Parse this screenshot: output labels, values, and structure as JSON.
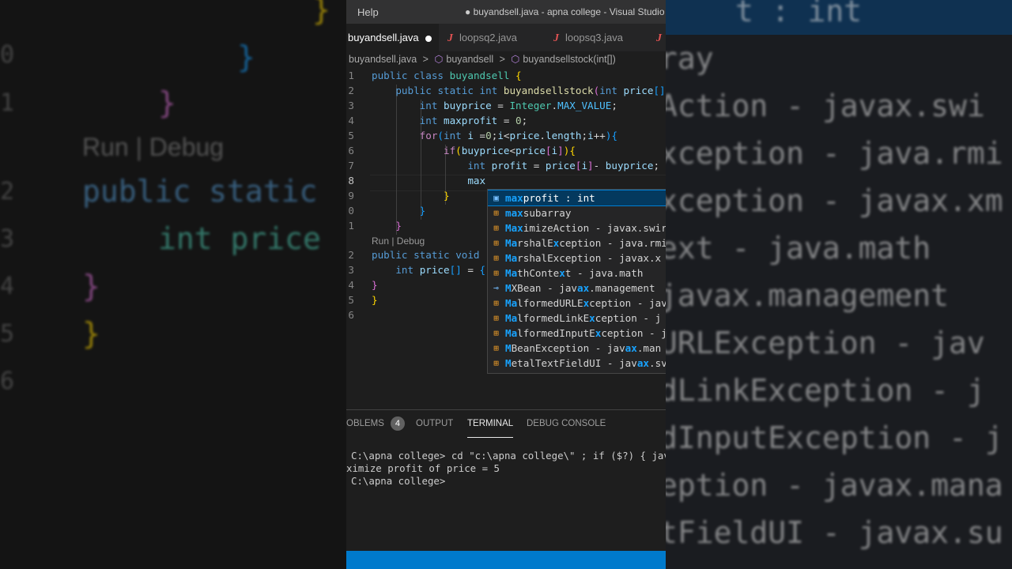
{
  "titlebar": {
    "menu_help": "Help",
    "window_title": "● buyandsell.java - apna college - Visual Studio C"
  },
  "tabs": [
    {
      "label": "buyandsell.java",
      "active": true,
      "modified": true
    },
    {
      "label": "loopsq2.java",
      "active": false
    },
    {
      "label": "loopsq3.java",
      "active": false
    },
    {
      "label": "J",
      "active": false
    }
  ],
  "breadcrumb": [
    "buyandsell.java",
    ">",
    "buyandsell",
    ">",
    "buyandsellstock(int[])"
  ],
  "editor": {
    "line_numbers": [
      "1",
      "2",
      "3",
      "4",
      "5",
      "6",
      "7",
      "8",
      "9",
      "0",
      "1",
      "2",
      "3",
      "4",
      "5",
      "6"
    ],
    "codelens": "Run | Debug",
    "typed": "max"
  },
  "suggestions": [
    {
      "match": "max",
      "rest": "profit : int",
      "kind": "field-icon",
      "selected": true
    },
    {
      "match": "max",
      "rest": "subarray",
      "kind": "class-icon"
    },
    {
      "match": "Max",
      "rest": "imizeAction - javax.swir",
      "kind": "class-icon"
    },
    {
      "match": "Ma",
      "rest": "rshalE",
      "x": "x",
      "rest2": "ception - java.rmi",
      "kind": "class-icon"
    },
    {
      "match": "Ma",
      "rest": "rshalException - javax.x",
      "kind": "class-icon"
    },
    {
      "match": "Ma",
      "rest": "thConte",
      "x": "x",
      "rest2": "t - java.math",
      "kind": "class-icon"
    },
    {
      "match": "M",
      "rest": "XBean - jav",
      "x": "ax",
      "rest2": ".management",
      "kind": "interface-icon"
    },
    {
      "match": "Ma",
      "rest": "lformedURLE",
      "x": "x",
      "rest2": "ception - jav",
      "kind": "class-icon"
    },
    {
      "match": "Ma",
      "rest": "lformedLinkE",
      "x": "x",
      "rest2": "ception - j",
      "kind": "class-icon"
    },
    {
      "match": "Ma",
      "rest": "lformedInputE",
      "x": "x",
      "rest2": "ception - j",
      "kind": "class-icon"
    },
    {
      "match": "M",
      "rest": "BeanException - jav",
      "x": "ax",
      "rest2": ".man",
      "kind": "class-icon"
    },
    {
      "match": "M",
      "rest": "etalTextFieldUI - jav",
      "x": "ax",
      "rest2": ".sv",
      "kind": "class-icon"
    }
  ],
  "panel": {
    "tabs": [
      "OBLEMS",
      "OUTPUT",
      "TERMINAL",
      "DEBUG CONSOLE"
    ],
    "problems_count": "4",
    "active_tab": "TERMINAL",
    "terminal_lines": [
      "C:\\apna college> cd \"c:\\apna college\\\" ; if ($?) { java",
      "ximize profit of price = 5",
      "C:\\apna college> "
    ]
  },
  "background": {
    "left_lines": [
      "}",
      "}",
      "}",
      "Run | Debug",
      "public static",
      "int price",
      "}",
      "}"
    ],
    "left_numbers": [
      "0",
      "1",
      "2",
      "3",
      "4",
      "5",
      "6"
    ],
    "right_lines": [
      "t : int",
      "ray",
      "Action - javax.swi",
      "xception - java.rmi",
      "xception - javax.xm",
      "ext - java.math",
      " javax.management",
      "URLException - jav",
      "dLinkException - j",
      "dInputException - j",
      "eption - javax.mana",
      "tFieldUI - javax.su"
    ]
  },
  "colors": {
    "accent": "#007acc",
    "selection": "#04395e",
    "highlight": "#18a3ff"
  }
}
